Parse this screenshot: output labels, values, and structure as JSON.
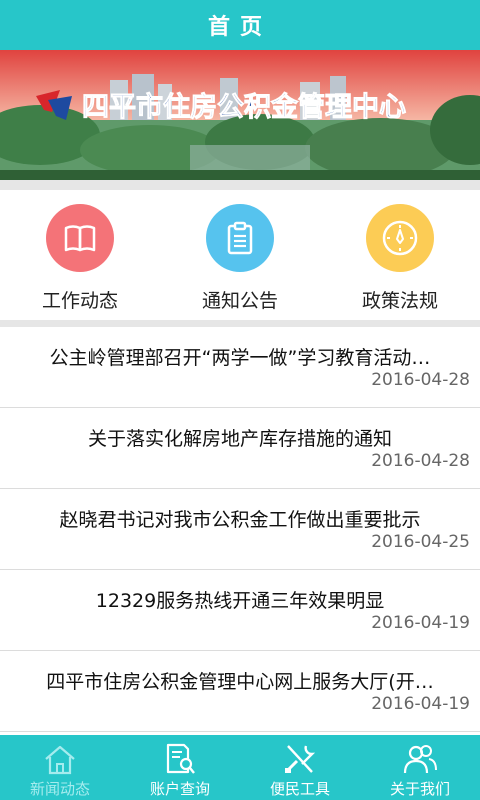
{
  "header": {
    "title": "首页"
  },
  "banner": {
    "name": "四平市住房公积金管理中心"
  },
  "categories": [
    {
      "label": "工作动态",
      "color": "#f47378",
      "icon": "book-icon"
    },
    {
      "label": "通知公告",
      "color": "#56c3ee",
      "icon": "clipboard-icon"
    },
    {
      "label": "政策法规",
      "color": "#fccc55",
      "icon": "compass-icon"
    }
  ],
  "news": [
    {
      "title": "公主岭管理部召开“两学一做”学习教育活动…",
      "date": "2016-04-28"
    },
    {
      "title": "关于落实化解房地产库存措施的通知",
      "date": "2016-04-28"
    },
    {
      "title": "赵晓君书记对我市公积金工作做出重要批示",
      "date": "2016-04-25"
    },
    {
      "title": "12329服务热线开通三年效果明显",
      "date": "2016-04-19"
    },
    {
      "title": "四平市住房公积金管理中心网上服务大厅(开…",
      "date": "2016-04-19"
    }
  ],
  "tabbar": {
    "items": [
      {
        "label": "新闻动态",
        "icon": "house-icon",
        "active": true
      },
      {
        "label": "账户查询",
        "icon": "search-document-icon",
        "active": false
      },
      {
        "label": "便民工具",
        "icon": "tools-icon",
        "active": false
      },
      {
        "label": "关于我们",
        "icon": "people-icon",
        "active": false
      }
    ]
  }
}
